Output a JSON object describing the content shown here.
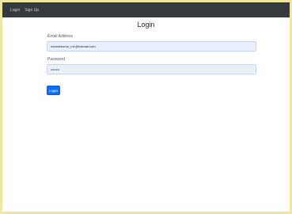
{
  "nav": {
    "links": [
      {
        "label": "Login"
      },
      {
        "label": "Sign Up"
      }
    ]
  },
  "form": {
    "title": "Login",
    "email_label": "Email Address",
    "email_value": "ncheseborne_m1@hotmail.com",
    "password_label": "Password",
    "password_value": "••••••••",
    "submit_label": "Login"
  },
  "colors": {
    "navbar": "#343a40",
    "input_autofill": "#e8f0fe",
    "primary_button": "#0d6efd",
    "outer_border": "#efe6a3"
  }
}
